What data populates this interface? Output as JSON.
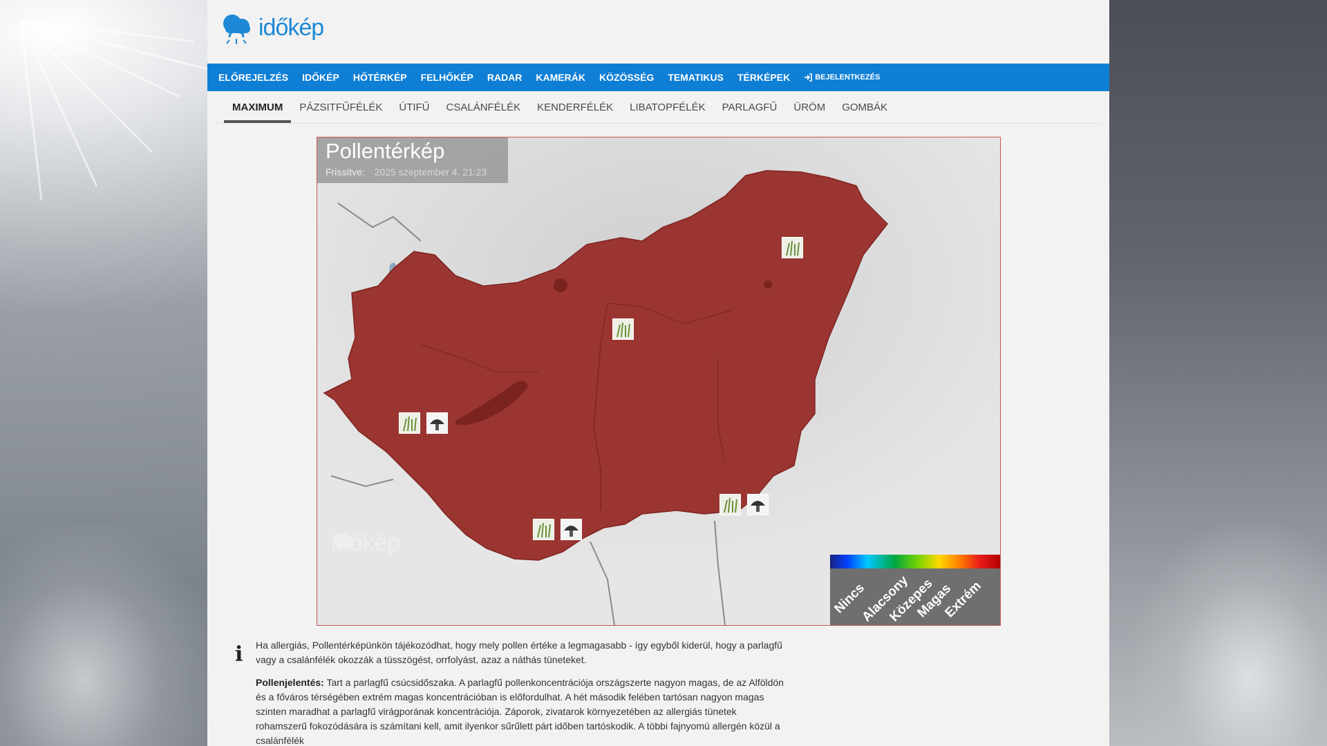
{
  "site": {
    "logo_text": "időkép"
  },
  "topnav": {
    "items": [
      "ELŐREJELZÉS",
      "IDŐKÉP",
      "HŐTÉRKÉP",
      "FELHŐKÉP",
      "RADAR",
      "KAMERÁK",
      "KÖZÖSSÉG",
      "TEMATIKUS",
      "TÉRKÉPEK"
    ],
    "login": "BEJELENTKEZÉS"
  },
  "subnav": {
    "tabs": [
      "MAXIMUM",
      "PÁZSITFŰFÉLÉK",
      "ÚTIFŰ",
      "CSALÁNFÉLÉK",
      "KENDERFÉLÉK",
      "LIBATOPFÉLÉK",
      "PARLAGFŰ",
      "ÜRÖM",
      "GOMBÁK"
    ],
    "active": "MAXIMUM"
  },
  "map": {
    "title": "Pollentérkép",
    "updated_label": "Frissítve:",
    "updated_value": "2025 szeptember 4. 21:23",
    "watermark": "időkép",
    "fill_color": "#9b3531",
    "legend": [
      "Nincs",
      "Alacsony",
      "Közepes",
      "Magas",
      "Extrém"
    ],
    "markers": [
      {
        "type": "grass-pollen-icon"
      },
      {
        "type": "grass-pollen-icon"
      },
      {
        "type": "grass-pollen-icon"
      },
      {
        "type": "mushroom-spore-icon"
      },
      {
        "type": "grass-pollen-icon"
      },
      {
        "type": "mushroom-spore-icon"
      },
      {
        "type": "grass-pollen-icon"
      },
      {
        "type": "mushroom-spore-icon"
      }
    ]
  },
  "info": {
    "intro": "Ha allergiás, Pollentérképünkön tájékozódhat, hogy mely pollen értéke a legmagasabb - így egyből kiderül, hogy a parlagfű vagy a csalánfélék okozzák a tüsszögést, orrfolyást, azaz a náthás tüneteket.",
    "report_label": "Pollenjelentés:",
    "report_text": "Tart a parlagfű csúcsidőszaka. A parlagfű pollenkoncentrációja országszerte nagyon magas, de az Alföldön és a főváros térségében extrém magas koncentrációban is előfordulhat. A hét második felében tartósan nagyon magas szinten maradhat a parlagfű virágporának koncentrációja. Záporok, zivatarok környezetében az allergiás tünetek rohamszerű fokozódására is számítani kell, amit ilyenkor sűrűlett párt időben tartóskodik. A többi fajnyomú allergén közül a csalánfélék"
  }
}
